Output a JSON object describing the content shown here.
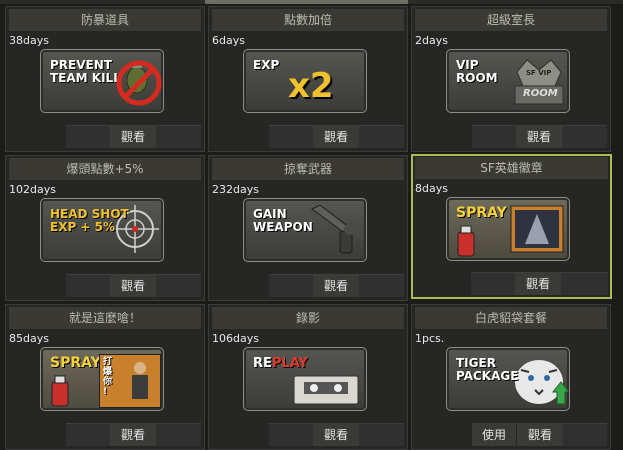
{
  "items": [
    {
      "title": "防暴道具",
      "duration": "38days",
      "badge_text": "PREVENT\nTEAM KILL",
      "view_label": "觀看"
    },
    {
      "title": "點數加倍",
      "duration": "6days",
      "badge_text": "EXP",
      "badge_big": "x2",
      "view_label": "觀看"
    },
    {
      "title": "超級室長",
      "duration": "2days",
      "badge_text": "VIP\nROOM",
      "badge_small": "SF VIP",
      "badge_room": "ROOM",
      "view_label": "觀看"
    },
    {
      "title": "爆頭點數+5%",
      "duration": "102days",
      "badge_text": "HEAD SHOT\nEXP + 5%",
      "view_label": "觀看"
    },
    {
      "title": "掠奪武器",
      "duration": "232days",
      "badge_text": "GAIN\nWEAPON",
      "view_label": "觀看"
    },
    {
      "title": "SF英雄徽章",
      "duration": "8days",
      "badge_text": "SPRAY",
      "view_label": "觀看"
    },
    {
      "title": "就是這麼嗆！",
      "duration": "85days",
      "badge_text": "SPRAY",
      "badge_side": "打\n爆\n你\n!",
      "view_label": "觀看"
    },
    {
      "title": "錄影",
      "duration": "106days",
      "badge_text_a": "RE",
      "badge_text_b": "PLAY",
      "view_label": "觀看"
    },
    {
      "title": "白虎貂袋套餐",
      "duration": "1pcs.",
      "badge_text": "TIGER\nPACKAGE",
      "use_label": "使用",
      "view_label": "觀看"
    }
  ],
  "colors": {
    "selected_border": "#a9bd50",
    "exp_gold": "#f2c12e",
    "replay_red": "#e03a2a",
    "spray_yellow": "#f6d23a"
  }
}
